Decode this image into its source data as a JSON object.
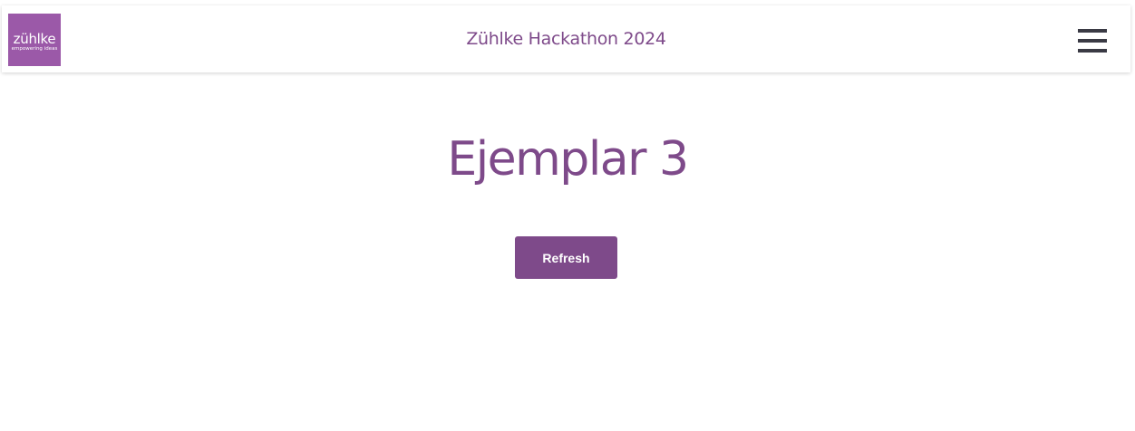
{
  "header": {
    "logo": {
      "name": "zühlke",
      "tagline": "empowering ideas"
    },
    "title": "Zühlke Hackathon 2024",
    "menu_icon": "hamburger-menu-icon"
  },
  "main": {
    "heading": "Ejemplar 3",
    "refresh_label": "Refresh"
  },
  "colors": {
    "brand_purple": "#7e4a8a",
    "logo_purple": "#9b59a8",
    "menu_icon": "#3a3a44"
  }
}
